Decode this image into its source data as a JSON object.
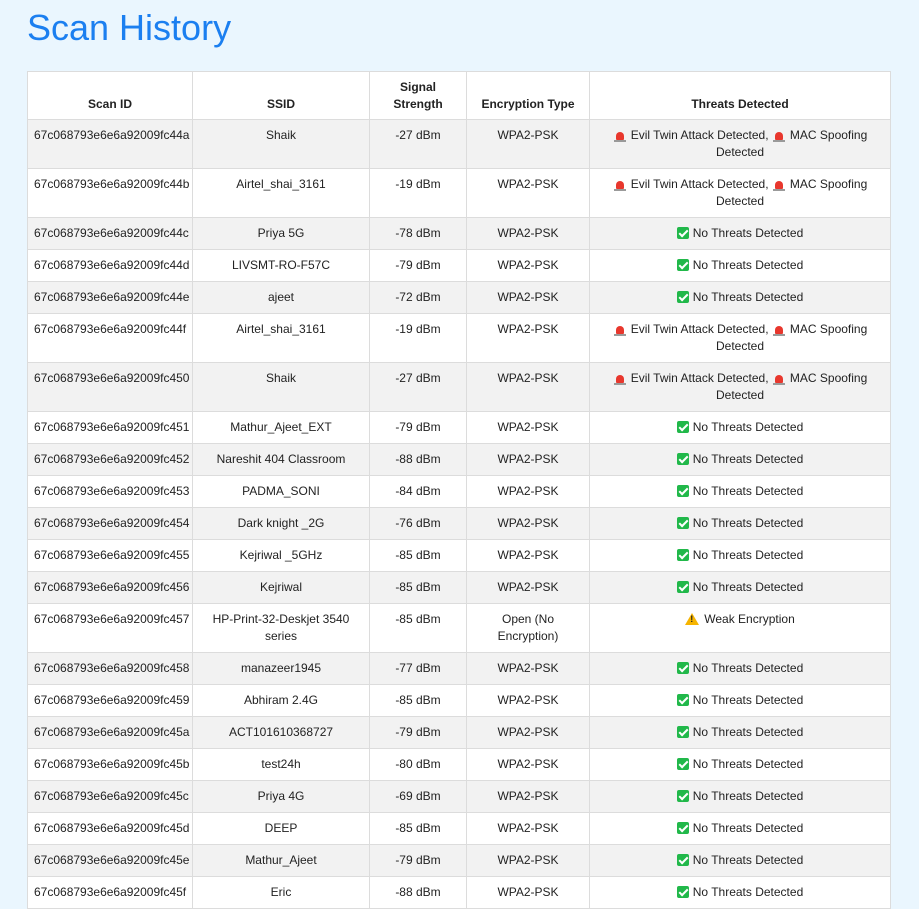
{
  "page": {
    "title": "Scan History"
  },
  "table": {
    "headers": {
      "scan_id": "Scan ID",
      "ssid": "SSID",
      "signal": "Signal Strength",
      "encryption": "Encryption Type",
      "threats": "Threats Detected"
    },
    "threat_separator": ",",
    "threat_icons": {
      "evil": "alarm-icon",
      "mac": "alarm-icon",
      "none": "check-icon",
      "weak": "warning-icon"
    },
    "rows": [
      {
        "id": "67c068793e6e6a92009fc44a",
        "ssid": "Shaik",
        "signal": "-27 dBm",
        "encryption": "WPA2-PSK",
        "threats": [
          "evil",
          "mac"
        ]
      },
      {
        "id": "67c068793e6e6a92009fc44b",
        "ssid": "Airtel_shai_3161",
        "signal": "-19 dBm",
        "encryption": "WPA2-PSK",
        "threats": [
          "evil",
          "mac"
        ]
      },
      {
        "id": "67c068793e6e6a92009fc44c",
        "ssid": "Priya 5G",
        "signal": "-78 dBm",
        "encryption": "WPA2-PSK",
        "threats": [
          "none"
        ]
      },
      {
        "id": "67c068793e6e6a92009fc44d",
        "ssid": "LIVSMT-RO-F57C",
        "signal": "-79 dBm",
        "encryption": "WPA2-PSK",
        "threats": [
          "none"
        ]
      },
      {
        "id": "67c068793e6e6a92009fc44e",
        "ssid": "ajeet",
        "signal": "-72 dBm",
        "encryption": "WPA2-PSK",
        "threats": [
          "none"
        ]
      },
      {
        "id": "67c068793e6e6a92009fc44f",
        "ssid": "Airtel_shai_3161",
        "signal": "-19 dBm",
        "encryption": "WPA2-PSK",
        "threats": [
          "evil",
          "mac"
        ]
      },
      {
        "id": "67c068793e6e6a92009fc450",
        "ssid": "Shaik",
        "signal": "-27 dBm",
        "encryption": "WPA2-PSK",
        "threats": [
          "evil",
          "mac"
        ]
      },
      {
        "id": "67c068793e6e6a92009fc451",
        "ssid": "Mathur_Ajeet_EXT",
        "signal": "-79 dBm",
        "encryption": "WPA2-PSK",
        "threats": [
          "none"
        ]
      },
      {
        "id": "67c068793e6e6a92009fc452",
        "ssid": "Nareshit 404 Classroom",
        "signal": "-88 dBm",
        "encryption": "WPA2-PSK",
        "threats": [
          "none"
        ]
      },
      {
        "id": "67c068793e6e6a92009fc453",
        "ssid": "PADMA_SONI",
        "signal": "-84 dBm",
        "encryption": "WPA2-PSK",
        "threats": [
          "none"
        ]
      },
      {
        "id": "67c068793e6e6a92009fc454",
        "ssid": "Dark knight _2G",
        "signal": "-76 dBm",
        "encryption": "WPA2-PSK",
        "threats": [
          "none"
        ]
      },
      {
        "id": "67c068793e6e6a92009fc455",
        "ssid": "Kejriwal _5GHz",
        "signal": "-85 dBm",
        "encryption": "WPA2-PSK",
        "threats": [
          "none"
        ]
      },
      {
        "id": "67c068793e6e6a92009fc456",
        "ssid": "Kejriwal",
        "signal": "-85 dBm",
        "encryption": "WPA2-PSK",
        "threats": [
          "none"
        ]
      },
      {
        "id": "67c068793e6e6a92009fc457",
        "ssid": "HP-Print-32-Deskjet 3540 series",
        "signal": "-85 dBm",
        "encryption": "Open (No Encryption)",
        "threats": [
          "weak"
        ]
      },
      {
        "id": "67c068793e6e6a92009fc458",
        "ssid": "manazeer1945",
        "signal": "-77 dBm",
        "encryption": "WPA2-PSK",
        "threats": [
          "none"
        ]
      },
      {
        "id": "67c068793e6e6a92009fc459",
        "ssid": "Abhiram 2.4G",
        "signal": "-85 dBm",
        "encryption": "WPA2-PSK",
        "threats": [
          "none"
        ]
      },
      {
        "id": "67c068793e6e6a92009fc45a",
        "ssid": "ACT101610368727",
        "signal": "-79 dBm",
        "encryption": "WPA2-PSK",
        "threats": [
          "none"
        ]
      },
      {
        "id": "67c068793e6e6a92009fc45b",
        "ssid": "test24h",
        "signal": "-80 dBm",
        "encryption": "WPA2-PSK",
        "threats": [
          "none"
        ]
      },
      {
        "id": "67c068793e6e6a92009fc45c",
        "ssid": "Priya 4G",
        "signal": "-69 dBm",
        "encryption": "WPA2-PSK",
        "threats": [
          "none"
        ]
      },
      {
        "id": "67c068793e6e6a92009fc45d",
        "ssid": "DEEP",
        "signal": "-85 dBm",
        "encryption": "WPA2-PSK",
        "threats": [
          "none"
        ]
      },
      {
        "id": "67c068793e6e6a92009fc45e",
        "ssid": "Mathur_Ajeet",
        "signal": "-79 dBm",
        "encryption": "WPA2-PSK",
        "threats": [
          "none"
        ]
      },
      {
        "id": "67c068793e6e6a92009fc45f",
        "ssid": "Eric",
        "signal": "-88 dBm",
        "encryption": "WPA2-PSK",
        "threats": [
          "none"
        ]
      }
    ]
  },
  "threat_labels": {
    "evil": "Evil Twin Attack Detected",
    "mac": "MAC Spoofing Detected",
    "none": "No Threats Detected",
    "weak": "Weak Encryption"
  },
  "colors": {
    "page_background": "#eaf6fe",
    "title": "#1b7ff0",
    "safe": "#21b84a",
    "danger": "#e8372d",
    "warning": "#f6b400"
  }
}
